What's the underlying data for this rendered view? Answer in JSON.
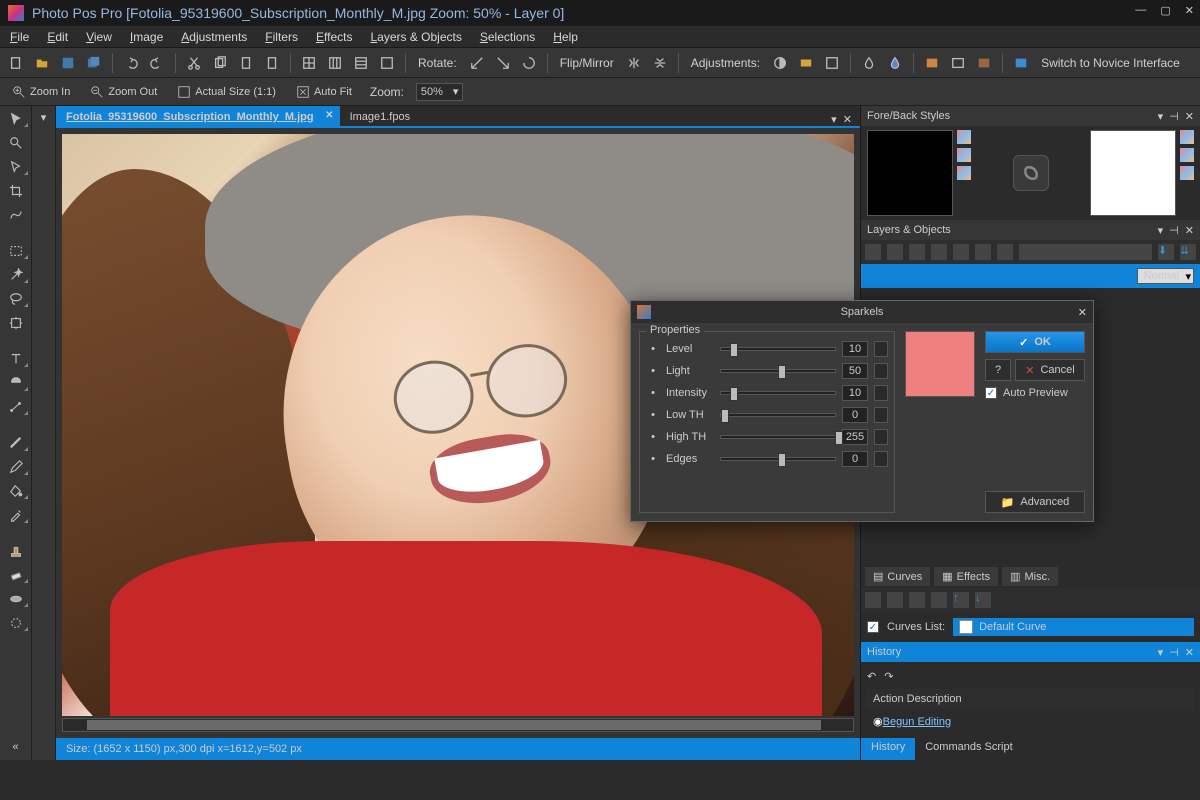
{
  "app": {
    "title": "Photo Pos Pro [Fotolia_95319600_Subscription_Monthly_M.jpg Zoom: 50% - Layer 0]"
  },
  "menu": [
    "File",
    "Edit",
    "View",
    "Image",
    "Adjustments",
    "Filters",
    "Effects",
    "Layers & Objects",
    "Selections",
    "Help"
  ],
  "toolbar1": {
    "rotate": "Rotate:",
    "flip": "Flip/Mirror",
    "adjust": "Adjustments:",
    "novice": "Switch to Novice Interface"
  },
  "toolbar2": {
    "zoomIn": "Zoom In",
    "zoomOut": "Zoom Out",
    "actual": "Actual Size (1:1)",
    "autoFit": "Auto Fit",
    "zoomLabel": "Zoom:",
    "zoomValue": "50%"
  },
  "docTabs": [
    {
      "label": "Fotolia_95319600_Subscription_Monthly_M.jpg",
      "active": true
    },
    {
      "label": "Image1.fpos",
      "active": false
    }
  ],
  "status": "Size: (1652 x 1150) px,300 dpi   x=1612,y=502 px",
  "panels": {
    "foreBack": "Fore/Back Styles",
    "layers": "Layers & Objects",
    "blend": "Normal",
    "tabs": [
      "Curves",
      "Effects",
      "Misc."
    ],
    "curvesList": "Curves List:",
    "curveName": "Default Curve",
    "history": "History",
    "actionHdr": "Action Description",
    "action1": "Begun Editing",
    "histTabs": [
      "History",
      "Commands Script"
    ]
  },
  "dialog": {
    "title": "Sparkels",
    "group": "Properties",
    "rows": [
      {
        "name": "Level",
        "value": "10",
        "pos": 8
      },
      {
        "name": "Light",
        "value": "50",
        "pos": 50
      },
      {
        "name": "Intensity",
        "value": "10",
        "pos": 8
      },
      {
        "name": "Low TH",
        "value": "0",
        "pos": 0
      },
      {
        "name": "High TH",
        "value": "255",
        "pos": 100
      },
      {
        "name": "Edges",
        "value": "0",
        "pos": 50
      }
    ],
    "ok": "OK",
    "cancel": "Cancel",
    "autoPreview": "Auto Preview",
    "advanced": "Advanced"
  }
}
